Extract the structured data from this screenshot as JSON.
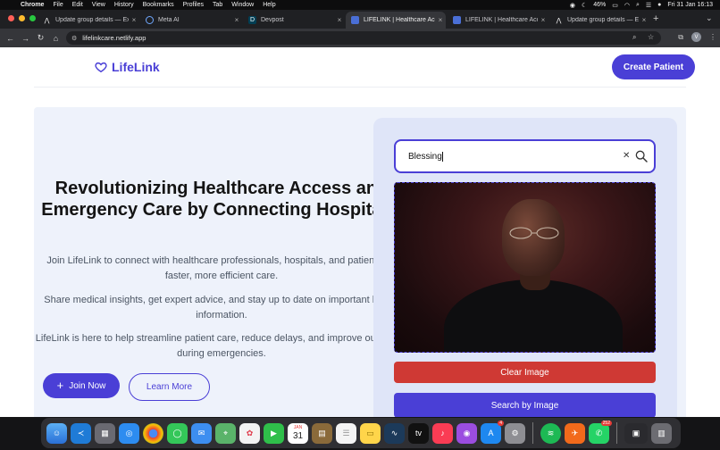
{
  "menubar": {
    "app": "Chrome",
    "items": [
      "File",
      "Edit",
      "View",
      "History",
      "Bookmarks",
      "Profiles",
      "Tab",
      "Window",
      "Help"
    ],
    "battery": "46%",
    "datetime": "Fri 31 Jan  16:13"
  },
  "tabs": [
    {
      "title": "Update group details — Expo"
    },
    {
      "title": "Meta AI"
    },
    {
      "title": "Devpost"
    },
    {
      "title": "LIFELINK | Healthcare Access"
    },
    {
      "title": "LIFELINK | Healthcare Access"
    },
    {
      "title": "Update group details — Expo"
    }
  ],
  "address": {
    "url": "lifelinkcare.netlify.app",
    "profile_initial": "V"
  },
  "site": {
    "logo": "LifeLink",
    "create_patient": "Create Patient",
    "hero_title": "Revolutionizing Healthcare Access and Emergency Care by Connecting Hospitals.",
    "para1": "Join LifeLink to connect with healthcare professionals, hospitals, and patients for faster, more efficient care.",
    "para2": "Share medical insights, get expert advice, and stay up to date on important health information.",
    "para3": "LifeLink is here to help streamline patient care, reduce delays, and improve outcomes during emergencies.",
    "join_now": "Join Now",
    "learn_more": "Learn More",
    "search_value": "Blessing",
    "clear_image": "Clear Image",
    "search_by_image": "Search by Image"
  },
  "dock": {
    "calendar_month": "JAN",
    "calendar_day": "31",
    "appstore_badge": "4",
    "whatsapp_badge": "252"
  }
}
